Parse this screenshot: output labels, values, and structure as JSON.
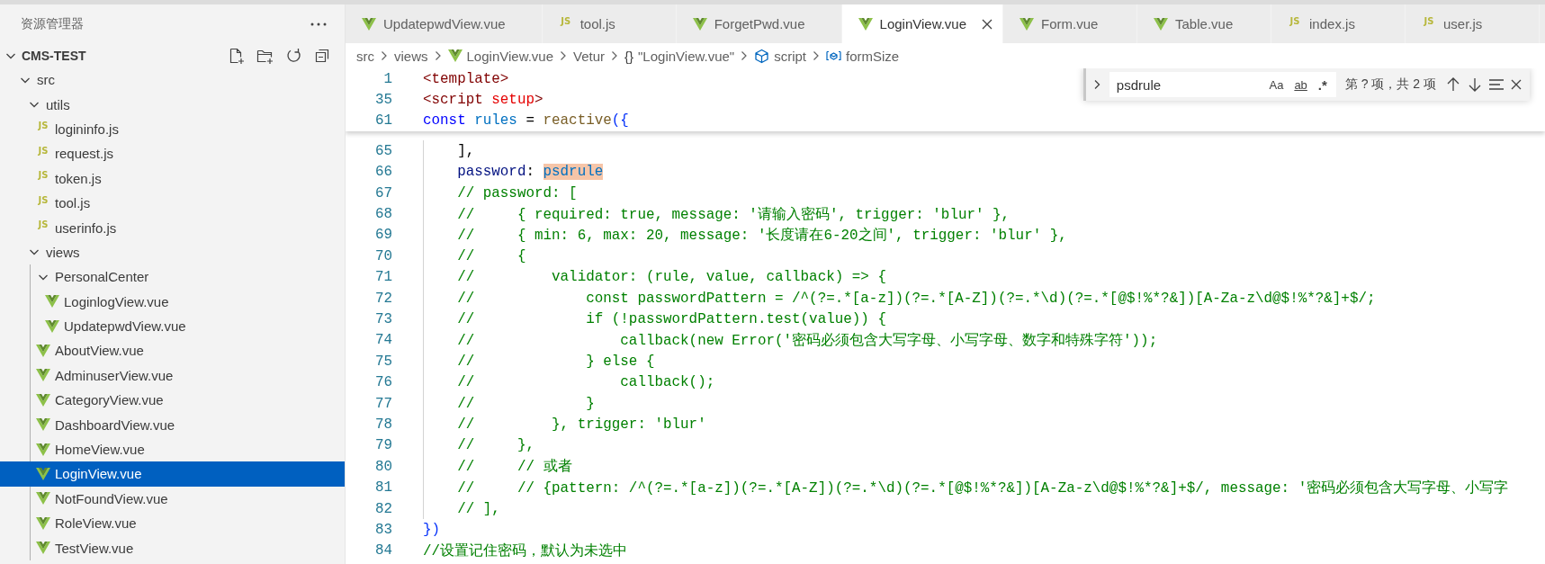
{
  "sidebar": {
    "title": "资源管理器",
    "workspace": {
      "title": "CMS-TEST",
      "expanded": true,
      "children": [
        {
          "label": "src",
          "kind": "folder",
          "expanded": true,
          "selected": false,
          "children": [
            {
              "label": "utils",
              "kind": "folder",
              "expanded": true,
              "selected": false,
              "children": [
                {
                  "label": "logininfo.js",
                  "kind": "js",
                  "badge": "JS",
                  "selected": false
                },
                {
                  "label": "request.js",
                  "kind": "js",
                  "badge": "JS",
                  "selected": false
                },
                {
                  "label": "token.js",
                  "kind": "js",
                  "badge": "JS",
                  "selected": false
                },
                {
                  "label": "tool.js",
                  "kind": "js",
                  "badge": "JS",
                  "selected": false
                },
                {
                  "label": "userinfo.js",
                  "kind": "js",
                  "badge": "JS",
                  "selected": false
                }
              ]
            },
            {
              "label": "views",
              "kind": "folder",
              "expanded": true,
              "selected": false,
              "children": [
                {
                  "label": "PersonalCenter",
                  "kind": "folder",
                  "expanded": true,
                  "selected": false,
                  "children": [
                    {
                      "label": "LoginlogView.vue",
                      "kind": "vue",
                      "selected": false
                    },
                    {
                      "label": "UpdatepwdView.vue",
                      "kind": "vue",
                      "selected": false
                    }
                  ]
                },
                {
                  "label": "AboutView.vue",
                  "kind": "vue",
                  "selected": false
                },
                {
                  "label": "AdminuserView.vue",
                  "kind": "vue",
                  "selected": false
                },
                {
                  "label": "CategoryView.vue",
                  "kind": "vue",
                  "selected": false
                },
                {
                  "label": "DashboardView.vue",
                  "kind": "vue",
                  "selected": false
                },
                {
                  "label": "HomeView.vue",
                  "kind": "vue",
                  "selected": false
                },
                {
                  "label": "LoginView.vue",
                  "kind": "vue",
                  "selected": true
                },
                {
                  "label": "NotFoundView.vue",
                  "kind": "vue",
                  "selected": false
                },
                {
                  "label": "RoleView.vue",
                  "kind": "vue",
                  "selected": false
                },
                {
                  "label": "TestView.vue",
                  "kind": "vue",
                  "selected": false
                }
              ]
            }
          ]
        }
      ]
    }
  },
  "tabs": [
    {
      "label": "UpdatepwdView.vue",
      "kind": "vue",
      "selected": false,
      "closable": false
    },
    {
      "label": "tool.js",
      "kind": "js",
      "badge": "JS",
      "selected": false,
      "closable": false
    },
    {
      "label": "ForgetPwd.vue",
      "kind": "vue",
      "selected": false,
      "closable": false
    },
    {
      "label": "LoginView.vue",
      "kind": "vue",
      "selected": true,
      "closable": true
    },
    {
      "label": "Form.vue",
      "kind": "vue",
      "selected": false,
      "closable": false
    },
    {
      "label": "Table.vue",
      "kind": "vue",
      "selected": false,
      "closable": false
    },
    {
      "label": "index.js",
      "kind": "js",
      "badge": "JS",
      "selected": false,
      "closable": false
    },
    {
      "label": "user.js",
      "kind": "js",
      "badge": "JS",
      "selected": false,
      "closable": false
    }
  ],
  "breadcrumb": [
    {
      "label": "src"
    },
    {
      "label": "views"
    },
    {
      "label": "LoginView.vue",
      "kind": "vue"
    },
    {
      "label": "Vetur"
    },
    {
      "label": "\"LoginView.vue\"",
      "glyph": "{}"
    },
    {
      "label": "script",
      "kind": "cube"
    },
    {
      "label": "formSize",
      "kind": "field"
    }
  ],
  "find": {
    "replace_expanded": false,
    "value": "psdrule",
    "options": [
      {
        "label": "Aa",
        "on": false
      },
      {
        "label": "ab",
        "on": false
      },
      {
        "label": ".*",
        "on": false
      }
    ],
    "count": "第 ? 项，共 2 项"
  },
  "code": {
    "sticky": [
      {
        "number": "1",
        "segments": [
          {
            "text": "<template>",
            "kind": "tag"
          }
        ]
      },
      {
        "number": "35",
        "segments": [
          {
            "text": "<script",
            "kind": "tag"
          },
          {
            "text": " setup",
            "kind": "attr"
          },
          {
            "text": ">",
            "kind": "tag"
          }
        ]
      },
      {
        "number": "61",
        "segments": [
          {
            "text": "const",
            "kind": "keyword"
          },
          {
            "text": " rules",
            "kind": "variable"
          },
          {
            "text": " = ",
            "kind": "plain"
          },
          {
            "text": "reactive",
            "kind": "function"
          },
          {
            "text": "({",
            "kind": "bracket"
          }
        ]
      }
    ],
    "lines": [
      {
        "number": "65",
        "segments": [
          {
            "text": "    ],",
            "kind": "plain"
          }
        ]
      },
      {
        "number": "66",
        "segments": [
          {
            "text": "    password",
            "kind": "property"
          },
          {
            "text": ": ",
            "kind": "plain"
          },
          {
            "text": "psdrule",
            "kind": "match"
          }
        ]
      },
      {
        "number": "67",
        "segments": [
          {
            "text": "    // password: [",
            "kind": "comment"
          }
        ]
      },
      {
        "number": "68",
        "segments": [
          {
            "text": "    //     { required: true, message: '请输入密码', trigger: 'blur' },",
            "kind": "comment"
          }
        ]
      },
      {
        "number": "69",
        "segments": [
          {
            "text": "    //     { min: 6, max: 20, message: '长度请在6-20之间', trigger: 'blur' },",
            "kind": "comment"
          }
        ]
      },
      {
        "number": "70",
        "segments": [
          {
            "text": "    //     {",
            "kind": "comment"
          }
        ]
      },
      {
        "number": "71",
        "segments": [
          {
            "text": "    //         validator: (rule, value, callback) => {",
            "kind": "comment"
          }
        ]
      },
      {
        "number": "72",
        "segments": [
          {
            "text": "    //             const passwordPattern = /^(?=.*[a-z])(?=.*[A-Z])(?=.*\\d)(?=.*[@$!%*?&])[A-Za-z\\d@$!%*?&]+$/;",
            "kind": "comment"
          }
        ]
      },
      {
        "number": "73",
        "segments": [
          {
            "text": "    //             if (!passwordPattern.test(value)) {",
            "kind": "comment"
          }
        ]
      },
      {
        "number": "74",
        "segments": [
          {
            "text": "    //                 callback(new Error('密码必须包含大写字母、小写字母、数字和特殊字符'));",
            "kind": "comment"
          }
        ]
      },
      {
        "number": "75",
        "segments": [
          {
            "text": "    //             } else {",
            "kind": "comment"
          }
        ]
      },
      {
        "number": "76",
        "segments": [
          {
            "text": "    //                 callback();",
            "kind": "comment"
          }
        ]
      },
      {
        "number": "77",
        "segments": [
          {
            "text": "    //             }",
            "kind": "comment"
          }
        ]
      },
      {
        "number": "78",
        "segments": [
          {
            "text": "    //         }, trigger: 'blur'",
            "kind": "comment"
          }
        ]
      },
      {
        "number": "79",
        "segments": [
          {
            "text": "    //     },",
            "kind": "comment"
          }
        ]
      },
      {
        "number": "80",
        "segments": [
          {
            "text": "    //     // 或者",
            "kind": "comment"
          }
        ]
      },
      {
        "number": "81",
        "segments": [
          {
            "text": "    //     // {pattern: /^(?=.*[a-z])(?=.*[A-Z])(?=.*\\d)(?=.*[@$!%*?&])[A-Za-z\\d@$!%*?&]+$/, message: '密码必须包含大写字母、小写字",
            "kind": "comment"
          }
        ]
      },
      {
        "number": "82",
        "segments": [
          {
            "text": "    // ],",
            "kind": "comment"
          }
        ]
      },
      {
        "number": "83",
        "segments": [
          {
            "text": "})",
            "kind": "bracket"
          }
        ]
      },
      {
        "number": "84",
        "segments": [
          {
            "text": "//设置记住密码，默认为未选中",
            "kind": "comment"
          }
        ]
      }
    ]
  }
}
